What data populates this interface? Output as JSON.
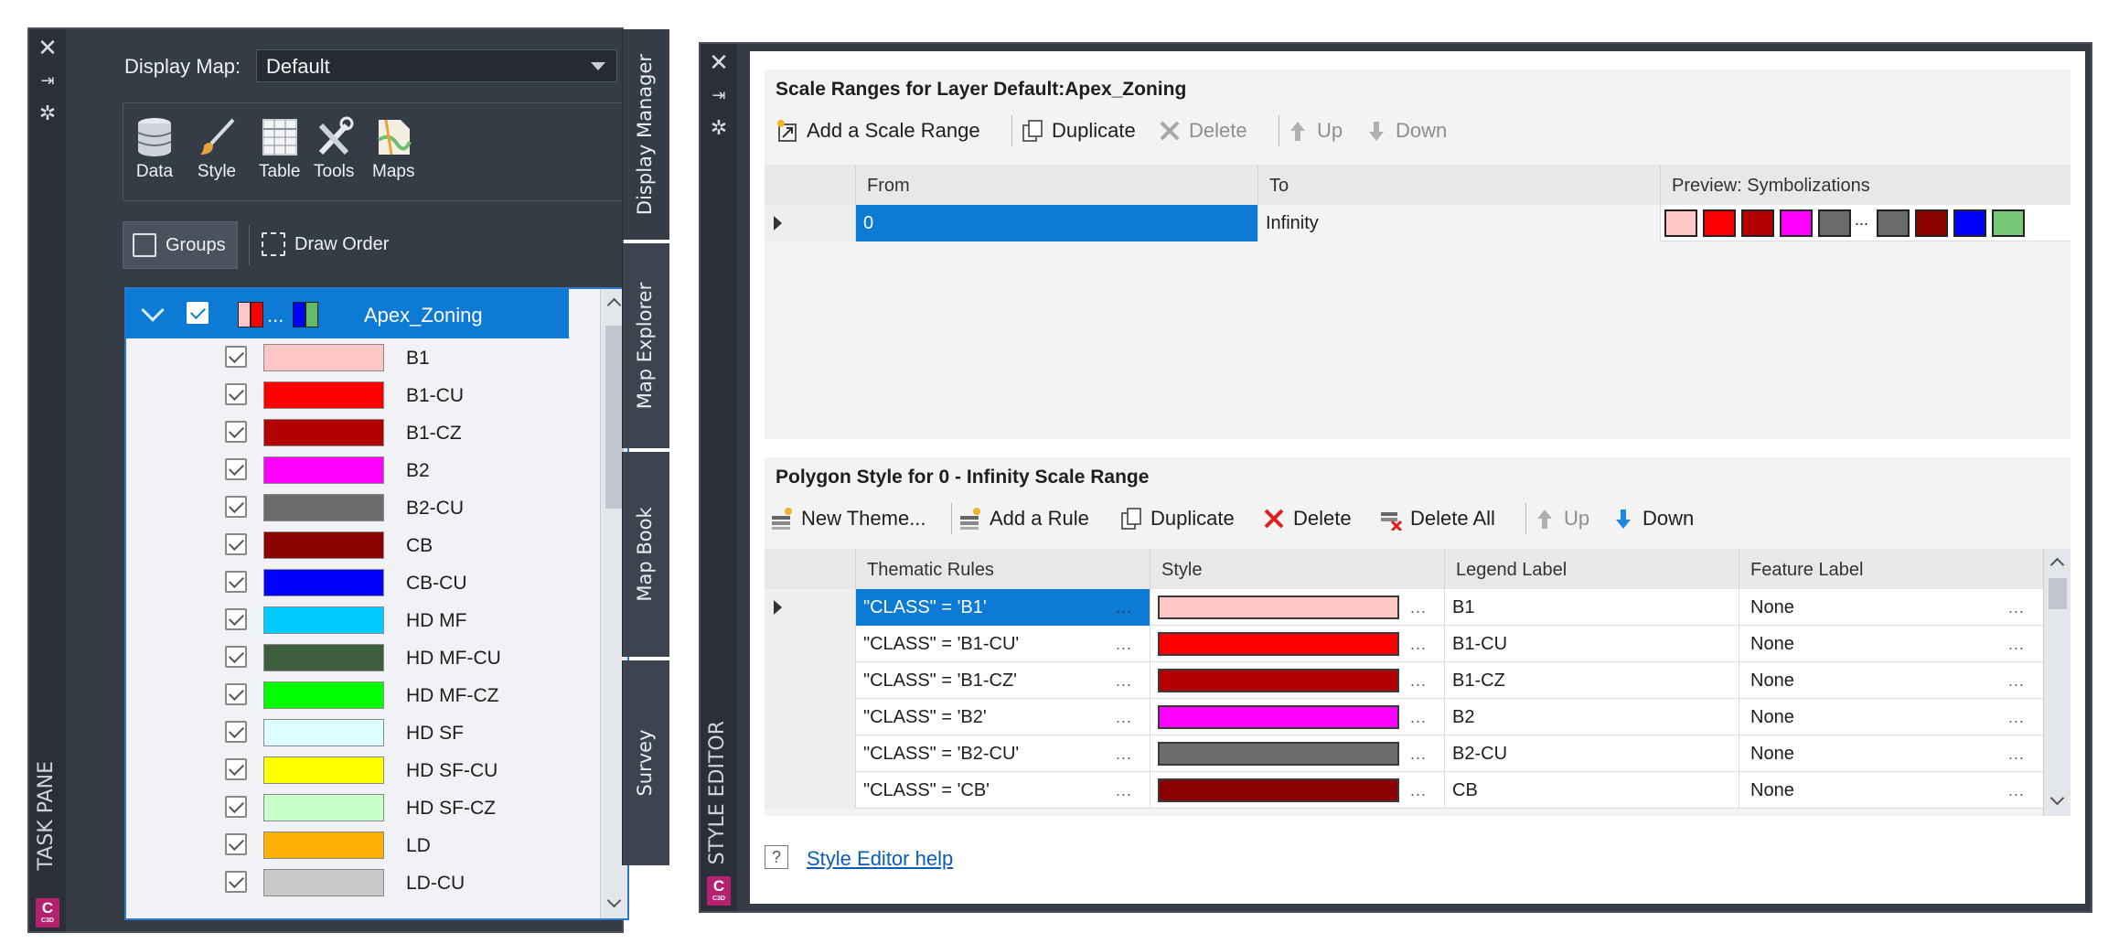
{
  "task_pane": {
    "title": "TASK PANE",
    "display_map_label": "Display Map:",
    "display_map_value": "Default",
    "tools": [
      {
        "label": "Data",
        "icon": "database-icon"
      },
      {
        "label": "Style",
        "icon": "paintbrush-icon"
      },
      {
        "label": "Table",
        "icon": "table-icon"
      },
      {
        "label": "Tools",
        "icon": "tools-icon"
      },
      {
        "label": "Maps",
        "icon": "map-icon"
      }
    ],
    "groups_label": "Groups",
    "draw_order_label": "Draw Order",
    "layer": {
      "name": "Apex_Zoning",
      "swatch_colors": [
        "#ffc8c8",
        "#ff0000",
        "#0000ff",
        "#66bb66"
      ],
      "ellipsis": "..."
    },
    "rules": [
      {
        "label": "B1",
        "color": "#ffc6c6"
      },
      {
        "label": "B1-CU",
        "color": "#ff0000"
      },
      {
        "label": "B1-CZ",
        "color": "#b30000"
      },
      {
        "label": "B2",
        "color": "#ff00ff"
      },
      {
        "label": "B2-CU",
        "color": "#6b6b6b"
      },
      {
        "label": "CB",
        "color": "#8b0000"
      },
      {
        "label": "CB-CU",
        "color": "#0000ff"
      },
      {
        "label": "HD MF",
        "color": "#00ccff"
      },
      {
        "label": "HD MF-CU",
        "color": "#3d5f3d"
      },
      {
        "label": "HD MF-CZ",
        "color": "#00ff00"
      },
      {
        "label": "HD SF",
        "color": "#dcffff"
      },
      {
        "label": "HD SF-CU",
        "color": "#ffff00"
      },
      {
        "label": "HD SF-CZ",
        "color": "#c8ffc8"
      },
      {
        "label": "LD",
        "color": "#ffb000"
      },
      {
        "label": "LD-CU",
        "color": "#c8c8c8"
      }
    ],
    "side_tabs": [
      "Display Manager",
      "Map Explorer",
      "Map Book",
      "Survey"
    ],
    "badge": "C",
    "badge_sub": "C3D"
  },
  "style_editor": {
    "title": "STYLE EDITOR",
    "scale_ranges_title": "Scale Ranges for Layer Default:Apex_Zoning",
    "scale_toolbar": {
      "add": "Add a Scale Range",
      "duplicate": "Duplicate",
      "delete": "Delete",
      "up": "Up",
      "down": "Down"
    },
    "scale_grid": {
      "headers": [
        "From",
        "To",
        "Preview: Symbolizations"
      ],
      "row": {
        "from": "0",
        "to": "Infinity"
      },
      "preview_colors_left": [
        "#ffc6c6",
        "#ff0000",
        "#b30000",
        "#ff00ff",
        "#6b6b6b"
      ],
      "preview_ellipsis": "...",
      "preview_colors_right": [
        "#6b6b6b",
        "#8b0000",
        "#0000ff",
        "#77c777"
      ]
    },
    "polygon_title": "Polygon Style for 0 - Infinity Scale Range",
    "polygon_toolbar": {
      "new_theme": "New Theme...",
      "add_rule": "Add a Rule",
      "duplicate": "Duplicate",
      "delete": "Delete",
      "delete_all": "Delete All",
      "up": "Up",
      "down": "Down"
    },
    "polygon_grid": {
      "headers": [
        "Thematic Rules",
        "Style",
        "Legend Label",
        "Feature Label"
      ],
      "rows": [
        {
          "rule": "\"CLASS\" = 'B1'",
          "color": "#ffc6c6",
          "legend": "B1",
          "feature": "None"
        },
        {
          "rule": "\"CLASS\" = 'B1-CU'",
          "color": "#ff0000",
          "legend": "B1-CU",
          "feature": "None"
        },
        {
          "rule": "\"CLASS\" = 'B1-CZ'",
          "color": "#b30000",
          "legend": "B1-CZ",
          "feature": "None"
        },
        {
          "rule": "\"CLASS\" = 'B2'",
          "color": "#ff00ff",
          "legend": "B2",
          "feature": "None"
        },
        {
          "rule": "\"CLASS\" = 'B2-CU'",
          "color": "#6b6b6b",
          "legend": "B2-CU",
          "feature": "None"
        },
        {
          "rule": "\"CLASS\" = 'CB'",
          "color": "#8b0000",
          "legend": "CB",
          "feature": "None"
        }
      ],
      "dots": "..."
    },
    "help_icon": "?",
    "help_link": "Style Editor help",
    "badge": "C",
    "badge_sub": "C3D"
  },
  "colors": {
    "panel_bg": "#363c46",
    "selection_blue": "#0d7bd6",
    "link_blue": "#0b5db8"
  }
}
